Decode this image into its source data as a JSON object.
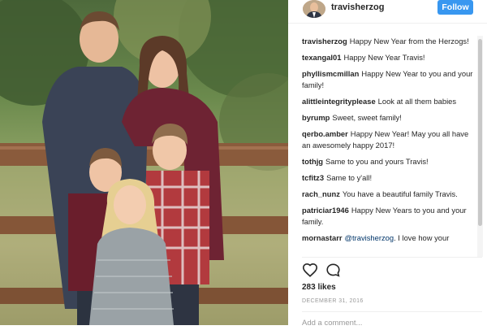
{
  "post": {
    "username": "travisherzog",
    "follow_label": "Follow",
    "likes": "283 likes",
    "date": "DECEMBER 31, 2016",
    "add_comment_placeholder": "Add a comment..."
  },
  "comments": [
    {
      "user": "travisherzog",
      "text": "Happy New Year from the Herzogs!"
    },
    {
      "user": "texangal01",
      "text": "Happy New Year Travis!"
    },
    {
      "user": "phyllismcmillan",
      "text": "Happy New Year to you and your family!"
    },
    {
      "user": "alittleintegrityplease",
      "text": "Look at all them babies"
    },
    {
      "user": "byrump",
      "text": "Sweet, sweet family!"
    },
    {
      "user": "qerbo.amber",
      "text": "Happy New Year! May you all have an awesomely happy 2017!"
    },
    {
      "user": "tothjg",
      "text": "Same to you and yours Travis!"
    },
    {
      "user": "tcfitz3",
      "text": "Same to y'all!"
    },
    {
      "user": "rach_nunz",
      "text": "You have a beautiful family Travis."
    },
    {
      "user": "patriciar1946",
      "text": "Happy New Years to you and your family."
    },
    {
      "user": "mornastarr",
      "mention": "@travisherzog",
      "text": ". I love how your"
    }
  ],
  "icons": {
    "heart": "heart-icon",
    "comment": "comment-icon",
    "avatar": "avatar"
  },
  "colors": {
    "follow_button": "#3897f0",
    "text": "#262626",
    "muted": "#999999"
  }
}
